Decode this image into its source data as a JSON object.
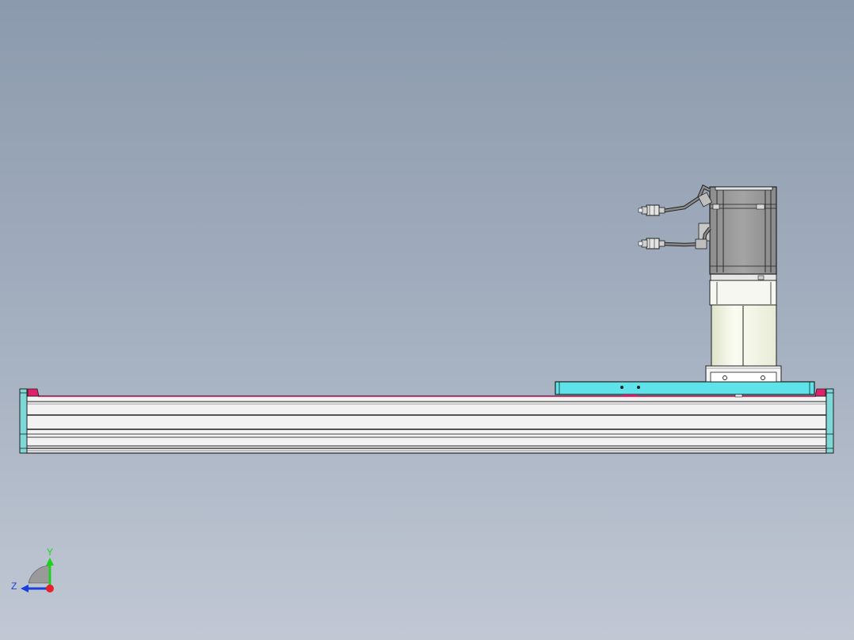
{
  "view": {
    "background_top": "#8b9aad",
    "background_bottom": "#c1c8d4"
  },
  "triad": {
    "y_label": "Y",
    "z_label": "Z",
    "y_color": "#1fd11f",
    "z_color": "#1a3fdc",
    "x_color": "#e8202a"
  },
  "colors": {
    "carriage_plate": "#5fe3ea",
    "end_cap": "#7fd8d8",
    "end_cap_accent": "#e0206a",
    "motor_body": "#9a9a9a",
    "coupling_housing": "#f3f5e6",
    "rail_body": "#f2f2f2",
    "outline": "#202020"
  },
  "icons": [
    "axis-triad-icon",
    "cable-connector-icon"
  ]
}
